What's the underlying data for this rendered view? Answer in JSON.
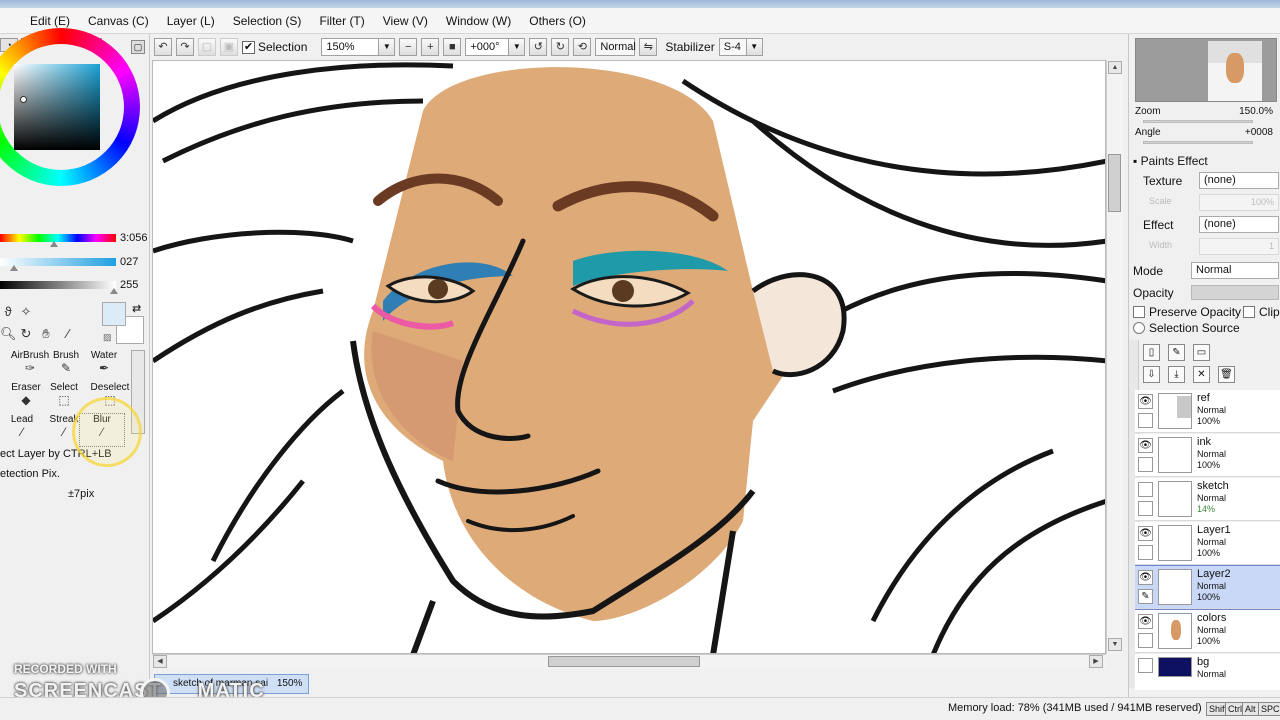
{
  "menu": [
    "Edit (E)",
    "Canvas (C)",
    "Layer (L)",
    "Selection (S)",
    "Filter (T)",
    "View (V)",
    "Window (W)",
    "Others (O)"
  ],
  "color_panel": {
    "hue_value": "3:056",
    "saturation_value": "027",
    "value_value": "255",
    "foreground_color": "#dcebf8",
    "background_color": "#ffffff"
  },
  "brush_tools": [
    {
      "label": "AirBrush",
      "icon": "airbrush-icon"
    },
    {
      "label": "Brush",
      "icon": "brush-icon"
    },
    {
      "label": "Water",
      "icon": "water-icon"
    },
    {
      "label": "Eraser",
      "icon": "eraser-icon"
    },
    {
      "label": "Select",
      "icon": "select-tool-icon"
    },
    {
      "label": "Deselect",
      "icon": "deselect-icon"
    },
    {
      "label": "Lead",
      "icon": "lead-icon"
    },
    {
      "label": "Streak",
      "icon": "streak-icon"
    },
    {
      "label": "Blur",
      "icon": "blur-icon"
    }
  ],
  "tool_options": {
    "select_layer_hint": "ect Layer by CTRL+LB",
    "detection_label": "etection Pix.",
    "detection_value": "±7pix"
  },
  "toolbar": {
    "selection_label": "Selection",
    "selection_checked": true,
    "zoom": "150%",
    "angle": "+000°",
    "blend_mode": "Normal",
    "stabilizer_label": "Stabilizer",
    "stabilizer_value": "S-4"
  },
  "document_tab": {
    "name": "sketch of marman.sai",
    "zoom": "150%"
  },
  "watermark": {
    "top": "RECORDED WITH",
    "brand": "SCREENCAST",
    "brand_end": "MATIC"
  },
  "status": {
    "memory": "Memory load: 78% (341MB used / 941MB reserved)",
    "keys": [
      "Shift",
      "Ctrl",
      "Alt",
      "SPC"
    ]
  },
  "navigator": {
    "zoom_label": "Zoom",
    "zoom_value": "150.0%",
    "angle_label": "Angle",
    "angle_value": "+0008"
  },
  "layer_props": {
    "paints_effect": "Paints Effect",
    "texture_label": "Texture",
    "texture_value": "(none)",
    "texture_scale_label": "Scale",
    "texture_scale_value": "100%",
    "effect_label": "Effect",
    "effect_value": "(none)",
    "effect_width_label": "Width",
    "effect_width_value": "1",
    "mode_label": "Mode",
    "mode_value": "Normal",
    "opacity_label": "Opacity",
    "preserve_opacity": "Preserve Opacity",
    "clipping": "Clipp",
    "selection_source": "Selection Source"
  },
  "layers": [
    {
      "name": "ref",
      "mode": "Normal",
      "opacity": "100%",
      "visible": true,
      "selected": false
    },
    {
      "name": "ink",
      "mode": "Normal",
      "opacity": "100%",
      "visible": true,
      "selected": false
    },
    {
      "name": "sketch",
      "mode": "Normal",
      "opacity": "14%",
      "visible": false,
      "selected": false
    },
    {
      "name": "Layer1",
      "mode": "Normal",
      "opacity": "100%",
      "visible": true,
      "selected": false
    },
    {
      "name": "Layer2",
      "mode": "Normal",
      "opacity": "100%",
      "visible": true,
      "selected": true
    },
    {
      "name": "colors",
      "mode": "Normal",
      "opacity": "100%",
      "visible": true,
      "selected": false
    },
    {
      "name": "bg",
      "mode": "Normal",
      "opacity": "",
      "visible": false,
      "selected": false
    }
  ]
}
